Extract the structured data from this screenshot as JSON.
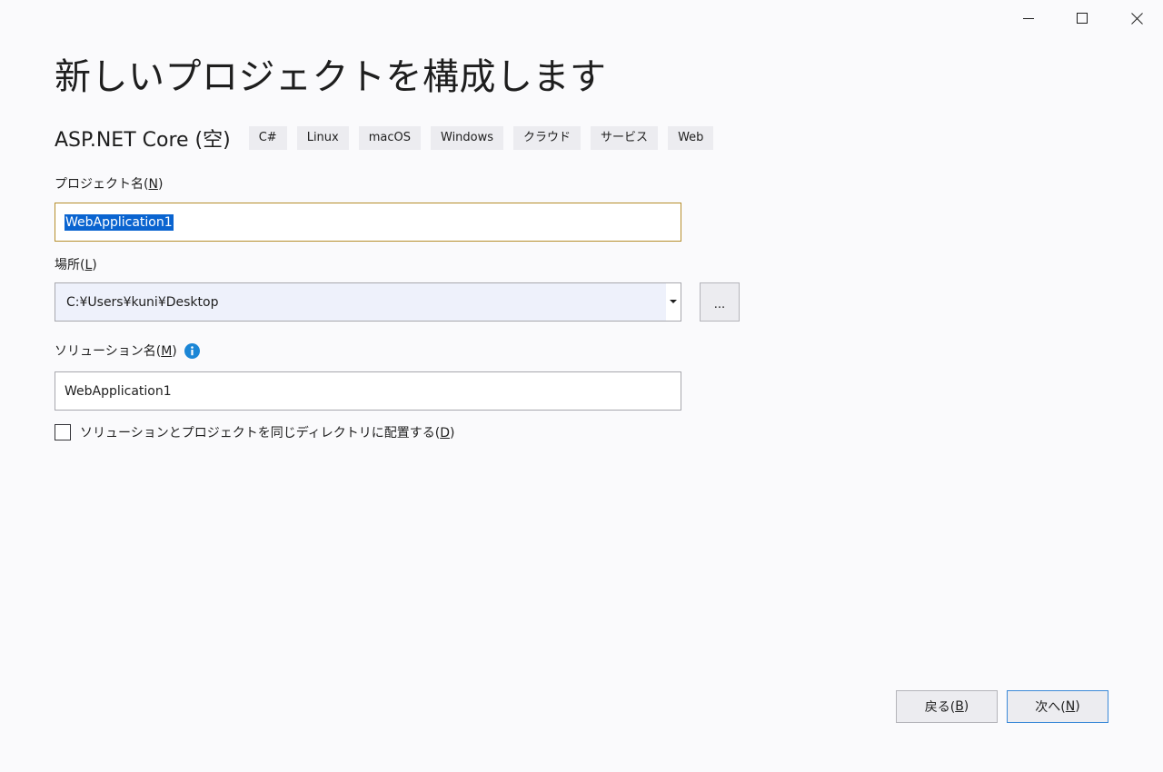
{
  "window": {
    "controls": {
      "minimize_icon": "minimize-icon",
      "maximize_icon": "maximize-icon",
      "close_icon": "close-icon"
    }
  },
  "header": {
    "title": "新しいプロジェクトを構成します"
  },
  "template": {
    "name": "ASP.NET Core (空)",
    "tags": [
      "C#",
      "Linux",
      "macOS",
      "Windows",
      "クラウド",
      "サービス",
      "Web"
    ]
  },
  "form": {
    "project_name": {
      "label": "プロジェクト名(",
      "access_key": "N",
      "label_suffix": ")",
      "value": "WebApplication1"
    },
    "location": {
      "label": "場所(",
      "access_key": "L",
      "label_suffix": ")",
      "value": "C:¥Users¥kuni¥Desktop",
      "browse_label": "..."
    },
    "solution_name": {
      "label": "ソリューション名(",
      "access_key": "M",
      "label_suffix": ")",
      "value": "WebApplication1",
      "info_icon": "info-icon"
    },
    "same_directory": {
      "label": "ソリューションとプロジェクトを同じディレクトリに配置する(",
      "access_key": "D",
      "label_suffix": ")",
      "checked": false
    }
  },
  "footer": {
    "back": {
      "label": "戻る(",
      "access_key": "B",
      "label_suffix": ")"
    },
    "next": {
      "label": "次へ(",
      "access_key": "N",
      "label_suffix": ")"
    }
  },
  "colors": {
    "accent_focus": "#b58e2c",
    "selection": "#0a64d0",
    "info_icon": "#1b86d6",
    "default_button_border": "#3c8ad8"
  }
}
